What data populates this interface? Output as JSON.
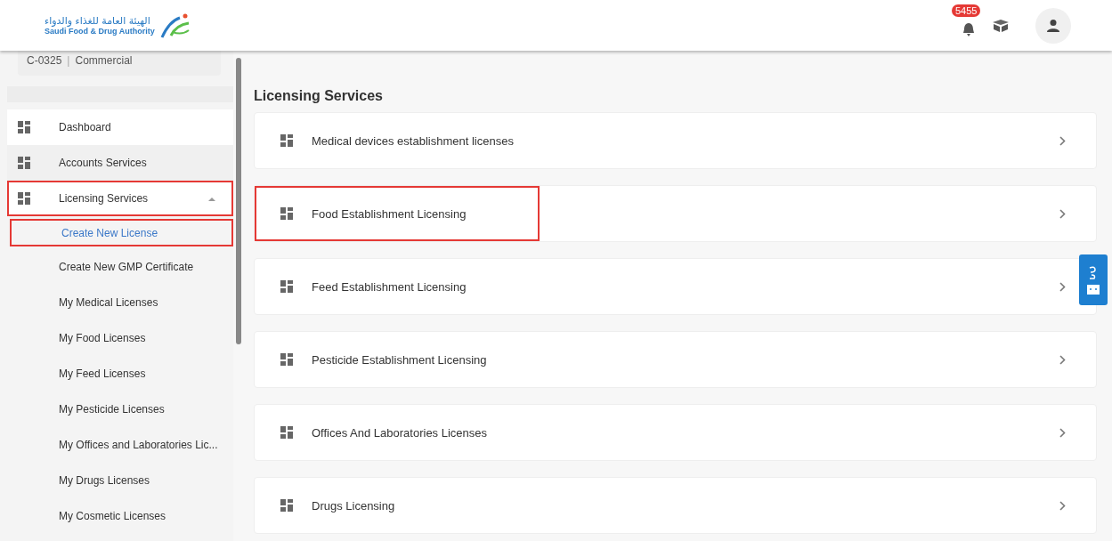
{
  "header": {
    "logo_arabic": "الهيئة العامة للغذاء والدواء",
    "logo_english": "Saudi Food & Drug Authority",
    "notification_count": "5455"
  },
  "account": {
    "code": "C-0325",
    "separator": "|",
    "type": "Commercial"
  },
  "sidebar": {
    "items": [
      {
        "label": "Dashboard",
        "selected": false,
        "highlighted": false
      },
      {
        "label": "Accounts Services",
        "selected": true,
        "highlighted": false
      },
      {
        "label": "Licensing Services",
        "selected": false,
        "highlighted": true,
        "expanded": true,
        "children": [
          {
            "label": "Create New License",
            "selected": true,
            "highlighted": true
          },
          {
            "label": "Create New GMP Certificate",
            "selected": false,
            "highlighted": false
          },
          {
            "label": "My Medical Licenses",
            "selected": false,
            "highlighted": false
          },
          {
            "label": "My Food Licenses",
            "selected": false,
            "highlighted": false
          },
          {
            "label": "My Feed Licenses",
            "selected": false,
            "highlighted": false
          },
          {
            "label": "My Pesticide Licenses",
            "selected": false,
            "highlighted": false
          },
          {
            "label": "My Offices and Laboratories Lic...",
            "selected": false,
            "highlighted": false
          },
          {
            "label": "My Drugs Licenses",
            "selected": false,
            "highlighted": false
          },
          {
            "label": "My Cosmetic Licenses",
            "selected": false,
            "highlighted": false
          }
        ]
      }
    ]
  },
  "main": {
    "title": "Licensing Services",
    "cards": [
      {
        "label": "Medical devices establishment licenses",
        "highlighted": false
      },
      {
        "label": "Food Establishment Licensing",
        "highlighted": true
      },
      {
        "label": "Feed Establishment Licensing",
        "highlighted": false
      },
      {
        "label": "Pesticide Establishment Licensing",
        "highlighted": false
      },
      {
        "label": "Offices And Laboratories Licenses",
        "highlighted": false
      },
      {
        "label": "Drugs Licensing",
        "highlighted": false
      }
    ]
  }
}
